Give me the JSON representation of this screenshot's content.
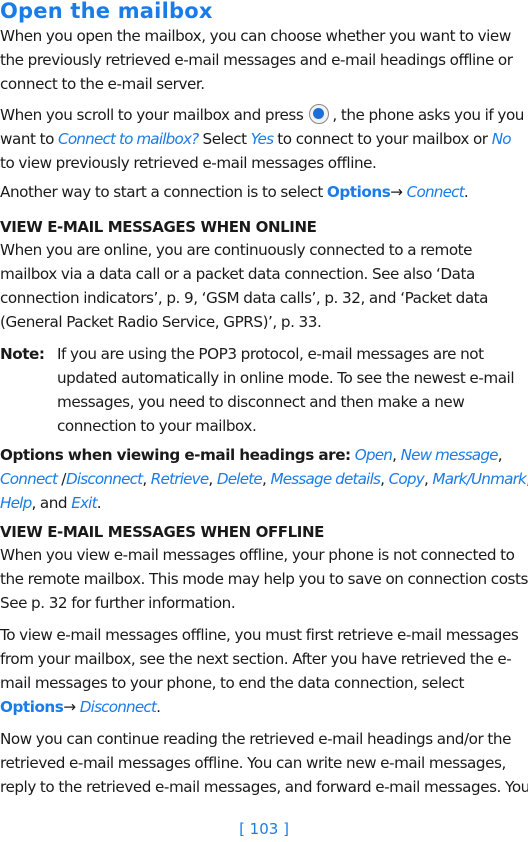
{
  "title": "Open the mailbox",
  "para1": [
    "When you open the mailbox, you can choose whether you want to view",
    "the previously retrieved e-mail messages and e-mail headings offline or",
    "connect to the e-mail server."
  ],
  "para2": {
    "l1_a": "When you scroll to your mailbox and press",
    "key_icon": "navi-key-select-icon",
    "l1_b": ", the phone asks you if you",
    "l2_a": "want to ",
    "l2_link1": "Connect to mailbox?",
    "l2_b": " Select ",
    "l2_link2": "Yes",
    "l2_c": " to connect to your mailbox or ",
    "l2_link3": "No",
    "l3": "to view previously retrieved e-mail messages offline."
  },
  "para3": {
    "text": "Another way to start a connection is to select ",
    "menu": "Options",
    "arrow": "→ ",
    "item": "Connect",
    "end": "."
  },
  "section_online": {
    "heading": "VIEW E-MAIL MESSAGES WHEN ONLINE",
    "lines": [
      "When you are online, you are continuously connected to a remote",
      "mailbox via a data call or a packet data connection. See also ‘Data",
      "connection indicators’, p. 9, ‘GSM data calls’, p. 32, and ‘Packet data",
      "(General Packet Radio Service, GPRS)’, p. 33."
    ]
  },
  "note": {
    "label": "Note:",
    "lines": [
      "If you are using the POP3 protocol, e-mail messages are not",
      "updated automatically in online mode. To see the newest e-mail",
      "messages, you need to disconnect and then make a new",
      "connection to your mailbox."
    ]
  },
  "options": {
    "label": "Options when viewing e-mail headings are:",
    "items": [
      "Open",
      "New message",
      "Connect",
      "Disconnect",
      "Retrieve",
      "Delete",
      "Message details",
      "Copy",
      "Mark/Unmark",
      "Help",
      "Exit"
    ],
    "sep_comma": ", ",
    "sep_slash": " /",
    "and": ", and ",
    "end": "."
  },
  "section_offline": {
    "heading": "VIEW E-MAIL MESSAGES WHEN OFFLINE",
    "lines": [
      "When you view e-mail messages offline, your phone is not connected to",
      "the remote mailbox. This mode may help you to save on connection costs.",
      "See p. 32 for further information."
    ]
  },
  "para_retrieve": {
    "lines": [
      "To view e-mail messages offline, you must first retrieve e-mail messages",
      "from your mailbox, see the next section. After you have retrieved the e-",
      "mail messages to your phone, to end the data connection, select"
    ],
    "menu": "Options",
    "arrow": "→ ",
    "item": "Disconnect",
    "end": "."
  },
  "para_continue": [
    "Now you can continue reading the retrieved e-mail headings and/or the",
    "retrieved e-mail messages offline. You can write new e-mail messages,",
    "reply to the retrieved e-mail messages, and forward e-mail messages. You"
  ],
  "page_number": "[ 103 ]",
  "colors": {
    "accent": "#1a7ce8",
    "text": "#1a1a1a"
  }
}
